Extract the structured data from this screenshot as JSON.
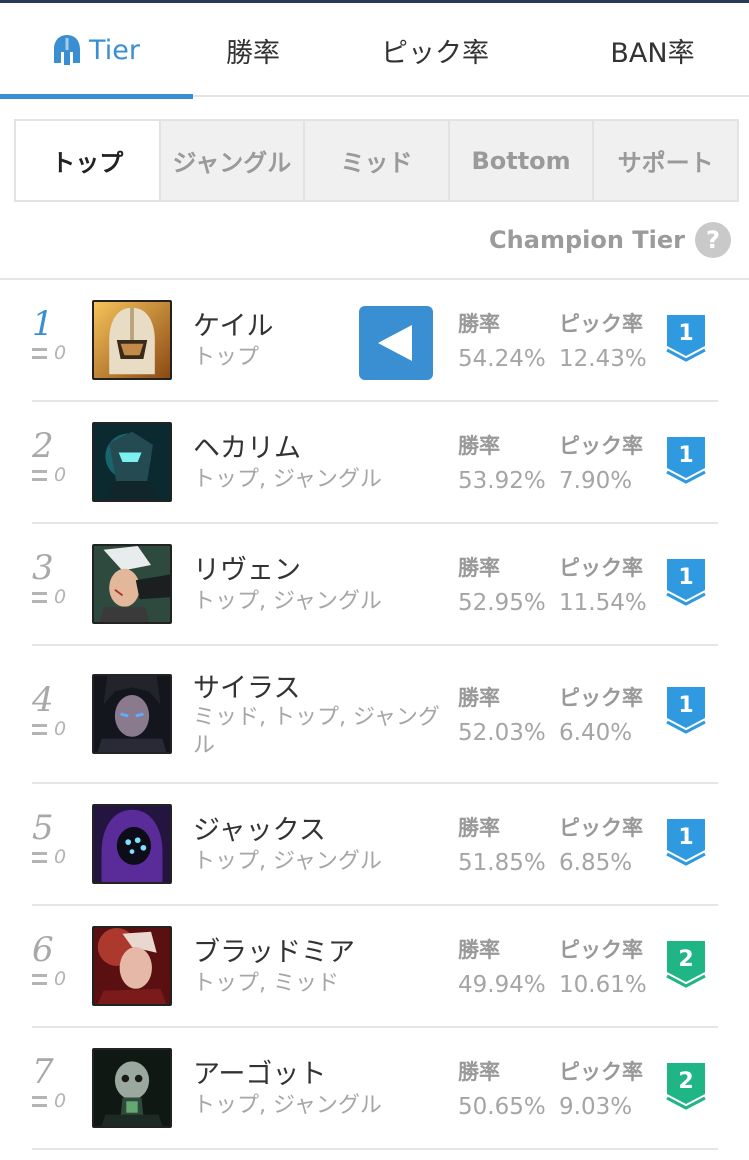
{
  "tabs": [
    {
      "label": "Tier",
      "active": true
    },
    {
      "label": "勝率",
      "active": false
    },
    {
      "label": "ピック率",
      "active": false
    },
    {
      "label": "BAN率",
      "active": false
    }
  ],
  "positions": [
    {
      "label": "トップ",
      "active": true
    },
    {
      "label": "ジャングル",
      "active": false
    },
    {
      "label": "ミッド",
      "active": false
    },
    {
      "label": "Bottom",
      "active": false
    },
    {
      "label": "サポート",
      "active": false
    }
  ],
  "champion_tier_label": "Champion Tier",
  "help_icon": "?",
  "column_labels": {
    "winrate": "勝率",
    "pickrate": "ピック率"
  },
  "champions": [
    {
      "rank": "1",
      "change": "0",
      "name": "ケイル",
      "lanes": "トップ",
      "winrate": "54.24%",
      "pickrate": "12.43%",
      "tier": "1"
    },
    {
      "rank": "2",
      "change": "0",
      "name": "ヘカリム",
      "lanes": "トップ, ジャングル",
      "winrate": "53.92%",
      "pickrate": "7.90%",
      "tier": "1"
    },
    {
      "rank": "3",
      "change": "0",
      "name": "リヴェン",
      "lanes": "トップ, ジャングル",
      "winrate": "52.95%",
      "pickrate": "11.54%",
      "tier": "1"
    },
    {
      "rank": "4",
      "change": "0",
      "name": "サイラス",
      "lanes": "ミッド, トップ, ジャングル",
      "winrate": "52.03%",
      "pickrate": "6.40%",
      "tier": "1"
    },
    {
      "rank": "5",
      "change": "0",
      "name": "ジャックス",
      "lanes": "トップ, ジャングル",
      "winrate": "51.85%",
      "pickrate": "6.85%",
      "tier": "1"
    },
    {
      "rank": "6",
      "change": "0",
      "name": "ブラッドミア",
      "lanes": "トップ, ミッド",
      "winrate": "49.94%",
      "pickrate": "10.61%",
      "tier": "2"
    },
    {
      "rank": "7",
      "change": "0",
      "name": "アーゴット",
      "lanes": "トップ, ジャングル",
      "winrate": "50.65%",
      "pickrate": "9.03%",
      "tier": "2"
    }
  ],
  "colors": {
    "accent": "#3a8fd3",
    "tier1": "#2f9ae0",
    "tier2": "#1fb585",
    "muted": "#a5a5a5"
  }
}
